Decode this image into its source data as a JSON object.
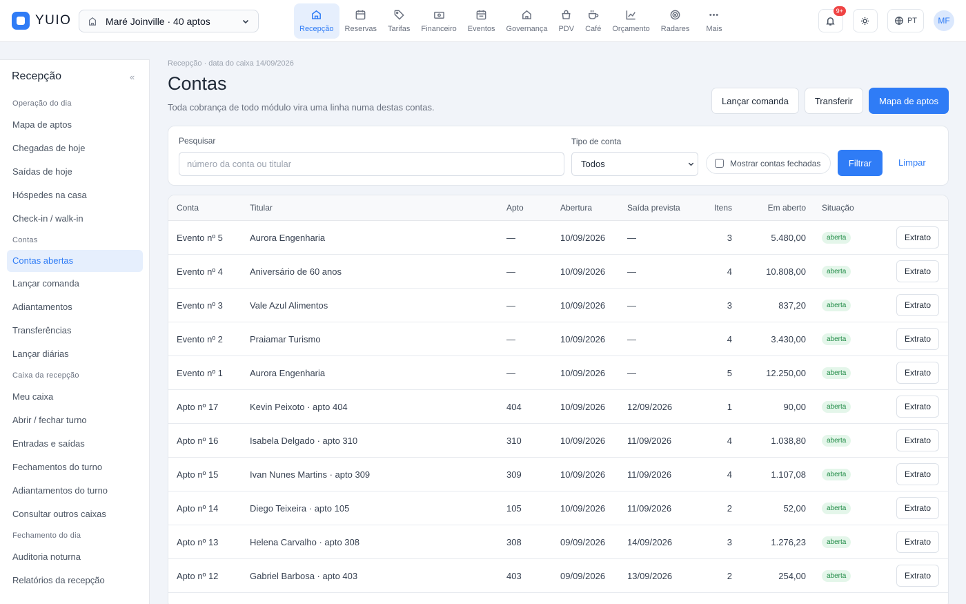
{
  "app": {
    "name": "YUIO"
  },
  "hotel_select": {
    "value": "Maré Joinville · 40 aptos"
  },
  "modules": [
    {
      "label": "Recepção",
      "icon": "home-icon",
      "active": true
    },
    {
      "label": "Reservas",
      "icon": "calendar-icon"
    },
    {
      "label": "Tarifas",
      "icon": "tag-icon"
    },
    {
      "label": "Financeiro",
      "icon": "cash-icon"
    },
    {
      "label": "Eventos",
      "icon": "calendar-event-icon"
    },
    {
      "label": "Governança",
      "icon": "house-icon"
    },
    {
      "label": "PDV",
      "icon": "shopping-bag-icon"
    },
    {
      "label": "Café",
      "icon": "coffee-icon"
    },
    {
      "label": "Orçamento",
      "icon": "chart-line-icon"
    },
    {
      "label": "Radares",
      "icon": "target-icon"
    },
    {
      "label": "Mais",
      "icon": "more-icon"
    }
  ],
  "header": {
    "notifications_badge": "9+",
    "language": "PT",
    "avatar": "MF"
  },
  "sidebar": {
    "title": "Recepção",
    "collapse": "«",
    "sections": [
      {
        "group": "Operação do dia",
        "items": [
          "Mapa de aptos",
          "Chegadas de hoje",
          "Saídas de hoje",
          "Hóspedes na casa",
          "Check-in / walk-in"
        ]
      },
      {
        "group": "Contas",
        "items": [
          "Contas abertas",
          "Lançar comanda",
          "Adiantamentos",
          "Transferências",
          "Lançar diárias"
        ]
      },
      {
        "group": "Caixa da recepção",
        "items": [
          "Meu caixa",
          "Abrir / fechar turno",
          "Entradas e saídas",
          "Fechamentos do turno",
          "Adiantamentos do turno",
          "Consultar outros caixas"
        ]
      },
      {
        "group": "Fechamento do dia",
        "items": [
          "Auditoria noturna",
          "Relatórios da recepção"
        ]
      }
    ],
    "active_item": "Contas abertas"
  },
  "page": {
    "breadcrumb": "Recepção · data do caixa 14/09/2026",
    "title": "Contas",
    "subtitle": "Toda cobrança de todo módulo vira uma linha numa destas contas.",
    "actions": {
      "launch": "Lançar comanda",
      "transfer": "Transferir",
      "map": "Mapa de aptos"
    }
  },
  "filters": {
    "search_label": "Pesquisar",
    "search_placeholder": "número da conta ou titular",
    "type_label": "Tipo de conta",
    "type_value": "Todos",
    "show_closed": "Mostrar contas fechadas",
    "filter_button": "Filtrar",
    "clear_link": "Limpar"
  },
  "table": {
    "headers": [
      "Conta",
      "Titular",
      "Apto",
      "Abertura",
      "Saída prevista",
      "Itens",
      "Em aberto",
      "Situação"
    ],
    "action_label": "Extrato",
    "rows": [
      {
        "conta": "Evento nº 5",
        "titular": "Aurora Engenharia",
        "apto": "—",
        "abertura": "10/09/2026",
        "saida": "—",
        "itens": "3",
        "aberto": "5.480,00",
        "situacao": "aberta"
      },
      {
        "conta": "Evento nº 4",
        "titular": "Aniversário de 60 anos",
        "apto": "—",
        "abertura": "10/09/2026",
        "saida": "—",
        "itens": "4",
        "aberto": "10.808,00",
        "situacao": "aberta"
      },
      {
        "conta": "Evento nº 3",
        "titular": "Vale Azul Alimentos",
        "apto": "—",
        "abertura": "10/09/2026",
        "saida": "—",
        "itens": "3",
        "aberto": "837,20",
        "situacao": "aberta"
      },
      {
        "conta": "Evento nº 2",
        "titular": "Praiamar Turismo",
        "apto": "—",
        "abertura": "10/09/2026",
        "saida": "—",
        "itens": "4",
        "aberto": "3.430,00",
        "situacao": "aberta"
      },
      {
        "conta": "Evento nº 1",
        "titular": "Aurora Engenharia",
        "apto": "—",
        "abertura": "10/09/2026",
        "saida": "—",
        "itens": "5",
        "aberto": "12.250,00",
        "situacao": "aberta"
      },
      {
        "conta": "Apto nº 17",
        "titular": "Kevin Peixoto · apto 404",
        "apto": "404",
        "abertura": "10/09/2026",
        "saida": "12/09/2026",
        "itens": "1",
        "aberto": "90,00",
        "situacao": "aberta"
      },
      {
        "conta": "Apto nº 16",
        "titular": "Isabela Delgado · apto 310",
        "apto": "310",
        "abertura": "10/09/2026",
        "saida": "11/09/2026",
        "itens": "4",
        "aberto": "1.038,80",
        "situacao": "aberta"
      },
      {
        "conta": "Apto nº 15",
        "titular": "Ivan Nunes Martins · apto 309",
        "apto": "309",
        "abertura": "10/09/2026",
        "saida": "11/09/2026",
        "itens": "4",
        "aberto": "1.107,08",
        "situacao": "aberta"
      },
      {
        "conta": "Apto nº 14",
        "titular": "Diego Teixeira · apto 105",
        "apto": "105",
        "abertura": "10/09/2026",
        "saida": "11/09/2026",
        "itens": "2",
        "aberto": "52,00",
        "situacao": "aberta"
      },
      {
        "conta": "Apto nº 13",
        "titular": "Helena Carvalho · apto 308",
        "apto": "308",
        "abertura": "09/09/2026",
        "saida": "14/09/2026",
        "itens": "3",
        "aberto": "1.276,23",
        "situacao": "aberta"
      },
      {
        "conta": "Apto nº 12",
        "titular": "Gabriel Barbosa · apto 403",
        "apto": "403",
        "abertura": "09/09/2026",
        "saida": "13/09/2026",
        "itens": "2",
        "aberto": "254,00",
        "situacao": "aberta"
      }
    ]
  }
}
